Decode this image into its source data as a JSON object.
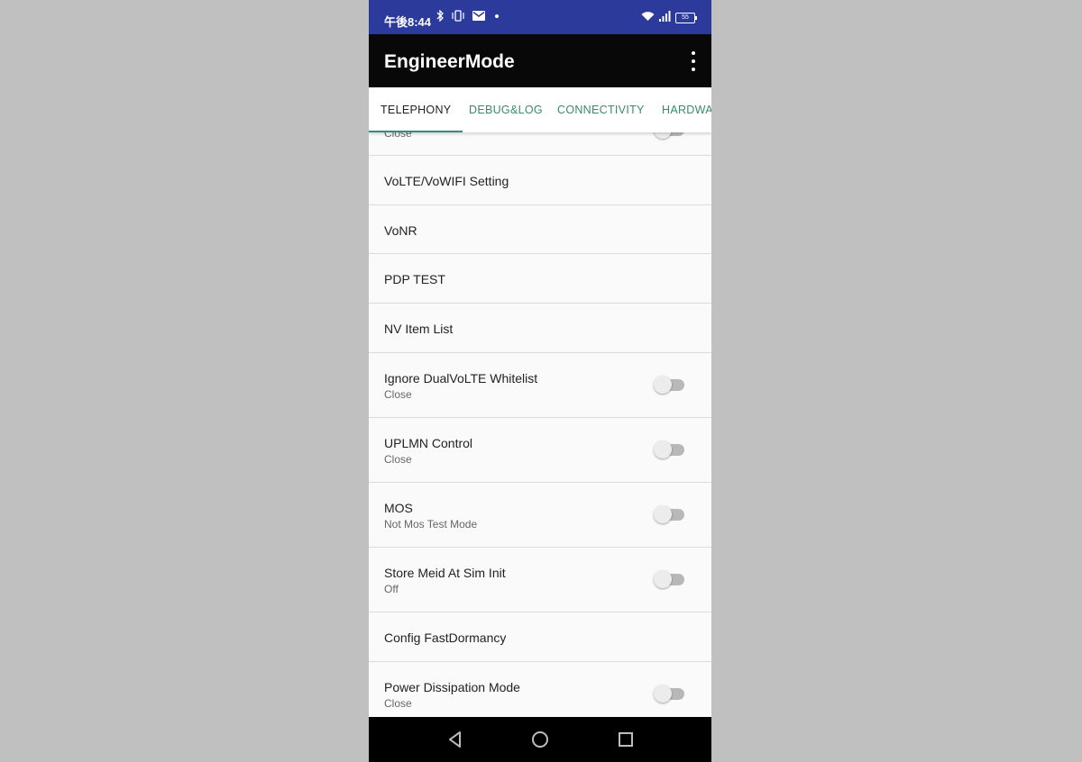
{
  "status_bar": {
    "time": "午後8:44",
    "left_icons": [
      "bluetooth-icon",
      "vibrate-icon",
      "mail-icon",
      "dot-icon"
    ],
    "right_icons": [
      "wifi-icon",
      "signal-icon",
      "battery-icon"
    ],
    "battery_level": "55"
  },
  "app_bar": {
    "title": "EngineerMode",
    "menu_icon": "more-vert-icon"
  },
  "tabs": [
    {
      "label": "TELEPHONY",
      "active": true
    },
    {
      "label": "DEBUG&LOG",
      "active": false
    },
    {
      "label": "CONNECTIVITY",
      "active": false
    },
    {
      "label": "HARDWARE",
      "active": false
    }
  ],
  "list": {
    "partial_item": {
      "subtitle": "Close",
      "toggle": false
    },
    "items": [
      {
        "title": "VoLTE/VoWIFI Setting"
      },
      {
        "title": "VoNR"
      },
      {
        "title": "PDP TEST"
      },
      {
        "title": "NV Item List"
      },
      {
        "title": "Ignore DualVoLTE Whitelist",
        "subtitle": "Close",
        "toggle": false
      },
      {
        "title": "UPLMN Control",
        "subtitle": "Close",
        "toggle": false
      },
      {
        "title": "MOS",
        "subtitle": "Not Mos Test Mode",
        "toggle": false
      },
      {
        "title": "Store Meid At Sim Init",
        "subtitle": "Off",
        "toggle": false
      },
      {
        "title": "Config FastDormancy"
      },
      {
        "title": "Power Dissipation Mode",
        "subtitle": "Close",
        "toggle": false
      }
    ]
  },
  "nav_bar": {
    "buttons": [
      "back-icon",
      "home-icon",
      "recents-icon"
    ]
  }
}
